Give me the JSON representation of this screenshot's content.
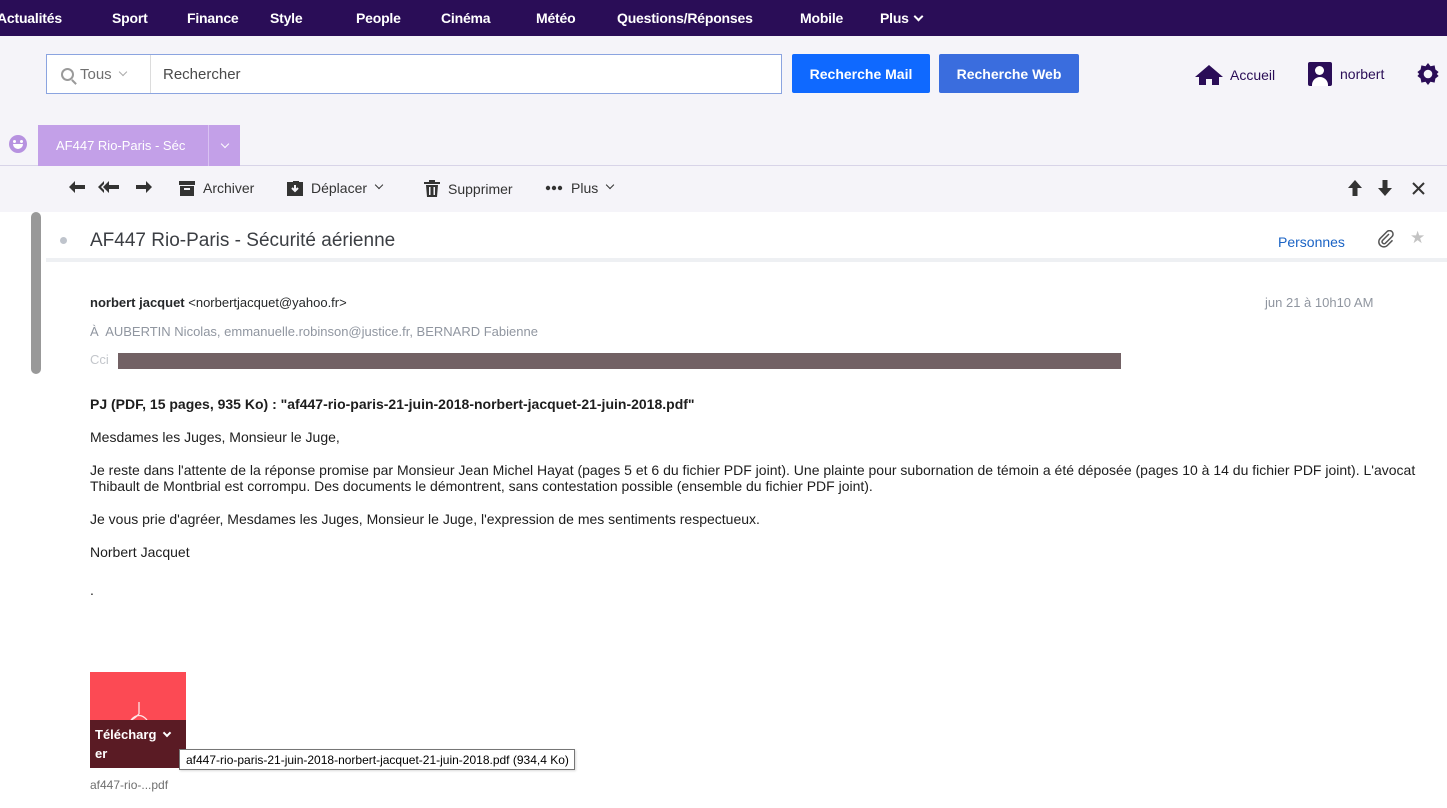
{
  "topnav": {
    "items": [
      "Actualités",
      "Sport",
      "Finance",
      "Style",
      "People",
      "Cinéma",
      "Météo",
      "Questions/Réponses",
      "Mobile",
      "Plus"
    ]
  },
  "header": {
    "search_scope": "Tous",
    "search_placeholder": "Rechercher",
    "search_mail_button": "Recherche Mail",
    "search_web_button": "Recherche Web",
    "home_label": "Accueil",
    "user_label": "norbert"
  },
  "tabs": {
    "active_tab_label": "AF447 Rio-Paris - Séc"
  },
  "toolbar": {
    "archive_label": "Archiver",
    "move_label": "Déplacer",
    "delete_label": "Supprimer",
    "more_label": "Plus"
  },
  "message": {
    "subject": "AF447 Rio-Paris - Sécurité aérienne",
    "people_link": "Personnes",
    "from_name": "norbert jacquet",
    "from_email": "<norbertjacquet@yahoo.fr>",
    "date": "jun 21 à 10h10 AM",
    "to_prefix": "À",
    "to_list": "AUBERTIN Nicolas, emmanuelle.robinson@justice.fr, BERNARD Fabienne",
    "cci_label": "Cci",
    "body": {
      "pj": "PJ (PDF, 15 pages, 935 Ko) : \"af447-rio-paris-21-juin-2018-norbert-jacquet-21-juin-2018.pdf\"",
      "greeting": "Mesdames les Juges, Monsieur le Juge,",
      "paragraph1": "Je reste dans l'attente de la réponse promise par Monsieur Jean Michel Hayat (pages 5 et 6 du fichier PDF joint). Une plainte pour subornation de témoin a été déposée (pages 10 à 14 du fichier PDF joint). L'avocat Thibault de Montbrial est corrompu. Des documents le démontrent, sans contestation possible (ensemble du fichier PDF joint).",
      "closing": "Je vous prie d'agréer, Mesdames les Juges, Monsieur le Juge, l'expression de mes sentiments respectueux.",
      "signature": "Norbert Jacquet",
      "dot": "."
    },
    "attachment": {
      "download_label": "Télécharg er",
      "download_label_line1": "Télécharg",
      "download_label_line2": "er",
      "short_name": "af447-rio-...pdf",
      "tooltip": "af447-rio-paris-21-juin-2018-norbert-jacquet-21-juin-2018.pdf (934,4 Ko)"
    }
  },
  "colors": {
    "nav_bg": "#2a0d57",
    "search_mail_btn": "#0f69ff",
    "search_web_btn": "#3a6dde",
    "tab_bg": "#c3a0e8",
    "attachment_bg": "#fc4a54",
    "link": "#1a63c5"
  },
  "icons": [
    "search-icon",
    "home-icon",
    "user-icon",
    "gear-icon",
    "smiley-icon",
    "reply-icon",
    "reply-all-icon",
    "forward-icon",
    "archive-icon",
    "move-icon",
    "trash-icon",
    "more-dots-icon",
    "arrow-up-icon",
    "arrow-down-icon",
    "close-icon",
    "paperclip-icon",
    "star-icon",
    "pdf-icon"
  ]
}
